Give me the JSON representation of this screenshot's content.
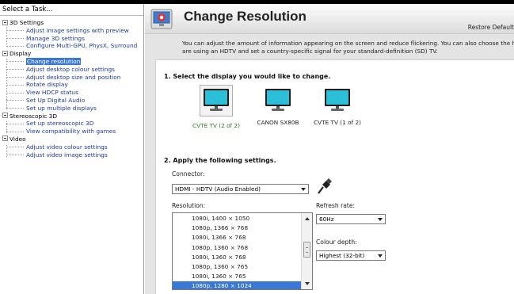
{
  "task_pane": {
    "header": "Select a Task...",
    "tree": [
      {
        "label": "3D Settings",
        "children": [
          {
            "label": "Adjust image settings with preview"
          },
          {
            "label": "Manage 3D settings"
          },
          {
            "label": "Configure Multi-GPU, PhysX, Surround"
          }
        ]
      },
      {
        "label": "Display",
        "children": [
          {
            "label": "Change resolution",
            "selected": true
          },
          {
            "label": "Adjust desktop colour settings"
          },
          {
            "label": "Adjust desktop size and position"
          },
          {
            "label": "Rotate display"
          },
          {
            "label": "View HDCP status"
          },
          {
            "label": "Set Up Digital Audio"
          },
          {
            "label": "Set up multiple displays"
          }
        ]
      },
      {
        "label": "Stereoscopic 3D",
        "children": [
          {
            "label": "Set up stereoscopic 3D"
          },
          {
            "label": "View compatibility with games"
          }
        ]
      },
      {
        "label": "Video",
        "children": [
          {
            "label": "Adjust video colour settings"
          },
          {
            "label": "Adjust video image settings"
          }
        ]
      }
    ]
  },
  "header": {
    "title": "Change Resolution",
    "restore_link": "Restore Default",
    "icon": "display-settings-icon"
  },
  "intro": {
    "line1": "You can adjust the amount of information appearing on the screen and reduce flickering. You can also choose the high-definition",
    "line2": "are using an HDTV and set a country-specific signal for your standard-definition (SD) TV."
  },
  "section1": {
    "title": "1. Select the display you would like to change.",
    "displays": [
      {
        "label": "CVTE TV (2 of 2)",
        "selected": true
      },
      {
        "label": "CANON SX80B",
        "selected": false
      },
      {
        "label": "CVTE TV (1 of 2)",
        "selected": false
      }
    ]
  },
  "section2": {
    "title": "2. Apply the following settings.",
    "connector_label": "Connector:",
    "connector_value": "HDMI - HDTV (Audio Enabled)",
    "connector_icon": "hdmi-plug-icon",
    "resolution_label": "Resolution:",
    "resolutions": [
      "1080i, 1400 × 1050",
      "1080p, 1366 × 768",
      "1080i, 1366 × 768",
      "1080p, 1360 × 768",
      "1080i, 1360 × 768",
      "1080p, 1360 × 765",
      "1080i, 1360 × 765",
      "1080p, 1280 × 1024"
    ],
    "selected_resolution_index": 7,
    "refresh_label": "Refresh rate:",
    "refresh_value": "60Hz",
    "colour_depth_label": "Colour depth:",
    "colour_depth_value": "Highest (32-bit)"
  },
  "colors": {
    "selection": "#3a78d8",
    "link": "#1d3b9c",
    "selected_display_label": "#2f7b1e",
    "panel_bg": "#e4e4e4"
  }
}
